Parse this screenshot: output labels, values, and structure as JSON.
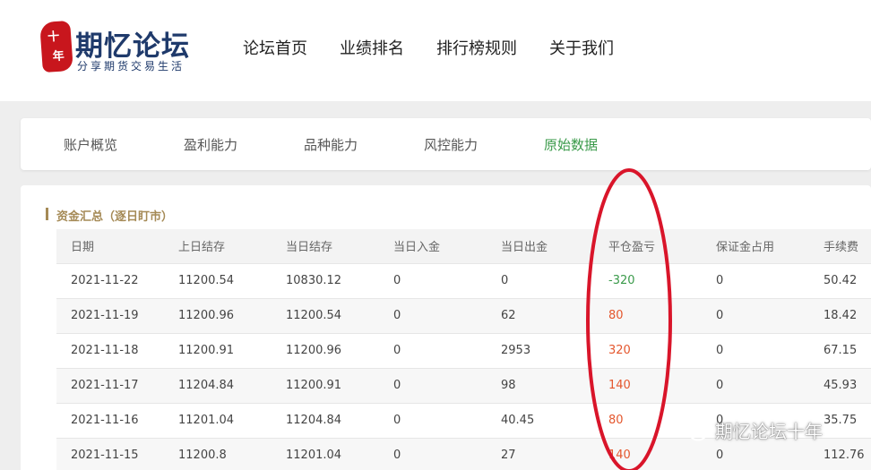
{
  "header": {
    "logo": {
      "seal_chars": [
        "十",
        "年"
      ],
      "title": "期忆论坛",
      "subtitle": "分享期货交易生活"
    },
    "nav": [
      {
        "label": "论坛首页"
      },
      {
        "label": "业绩排名"
      },
      {
        "label": "排行榜规则"
      },
      {
        "label": "关于我们"
      }
    ]
  },
  "tabs": [
    {
      "label": "账户概览",
      "active": false
    },
    {
      "label": "盈利能力",
      "active": false
    },
    {
      "label": "品种能力",
      "active": false
    },
    {
      "label": "风控能力",
      "active": false
    },
    {
      "label": "原始数据",
      "active": true
    }
  ],
  "section": {
    "title": "资金汇总（逐日盯市）"
  },
  "table": {
    "columns": [
      "日期",
      "上日结存",
      "当日结存",
      "当日入金",
      "当日出金",
      "平仓盈亏",
      "保证金占用",
      "手续费"
    ],
    "rows": [
      [
        "2021-11-22",
        "11200.54",
        "10830.12",
        "0",
        "0",
        "-320",
        "0",
        "50.42"
      ],
      [
        "2021-11-19",
        "11200.96",
        "11200.54",
        "0",
        "62",
        "80",
        "0",
        "18.42"
      ],
      [
        "2021-11-18",
        "11200.91",
        "11200.96",
        "0",
        "2953",
        "320",
        "0",
        "67.15"
      ],
      [
        "2021-11-17",
        "11204.84",
        "11200.91",
        "0",
        "98",
        "140",
        "0",
        "45.93"
      ],
      [
        "2021-11-16",
        "11201.04",
        "11204.84",
        "0",
        "40.45",
        "80",
        "0",
        "35.75"
      ],
      [
        "2021-11-15",
        "11200.8",
        "11201.04",
        "0",
        "27",
        "140",
        "0",
        "112.76"
      ]
    ]
  },
  "watermark": {
    "text": "期忆论坛十年",
    "icon": "wechat-icon"
  },
  "colors": {
    "brand_red": "#c8161d",
    "brand_navy": "#1f3a6b",
    "active_tab": "#3a9a4a",
    "section_gold": "#a58a56",
    "loss_green": "#3a9a4a",
    "profit_red": "#e4572e",
    "annotation": "#d9152a"
  }
}
